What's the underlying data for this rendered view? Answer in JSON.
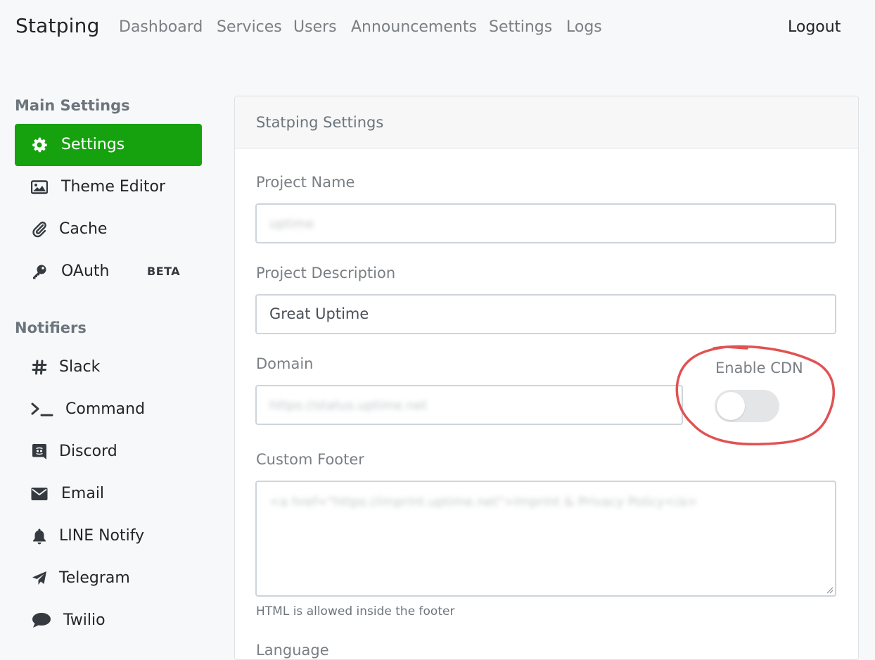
{
  "nav": {
    "brand": "Statping",
    "links": [
      "Dashboard",
      "Services",
      "Users",
      "Announcements",
      "Settings",
      "Logs"
    ],
    "logout": "Logout"
  },
  "sidebar": {
    "main_heading": "Main Settings",
    "main_items": [
      {
        "label": "Settings",
        "icon": "gear-icon",
        "active": true
      },
      {
        "label": "Theme Editor",
        "icon": "image-icon"
      },
      {
        "label": "Cache",
        "icon": "paperclip-icon"
      },
      {
        "label": "OAuth",
        "icon": "key-icon",
        "badge": "BETA"
      }
    ],
    "notifiers_heading": "Notifiers",
    "notifier_items": [
      {
        "label": "Slack",
        "icon": "hashtag-icon"
      },
      {
        "label": "Command",
        "icon": "terminal-icon"
      },
      {
        "label": "Discord",
        "icon": "discord-icon"
      },
      {
        "label": "Email",
        "icon": "envelope-icon"
      },
      {
        "label": "LINE Notify",
        "icon": "bell-icon"
      },
      {
        "label": "Telegram",
        "icon": "paper-plane-icon"
      },
      {
        "label": "Twilio",
        "icon": "comment-icon"
      }
    ],
    "active_color": "#16a20f"
  },
  "settings": {
    "card_title": "Statping Settings",
    "project_name_label": "Project Name",
    "project_name_value": "uptime",
    "project_description_label": "Project Description",
    "project_description_value": "Great Uptime",
    "domain_label": "Domain",
    "domain_value": "https://status.uptime.net",
    "enable_cdn_label": "Enable CDN",
    "enable_cdn_on": false,
    "custom_footer_label": "Custom Footer",
    "custom_footer_value": "<a href=\"https://imprint.uptime.net\">Imprint & Privacy Policy</a>",
    "footer_help": "HTML is allowed inside the footer",
    "language_label": "Language"
  },
  "annotation": {
    "color": "#e05252"
  }
}
